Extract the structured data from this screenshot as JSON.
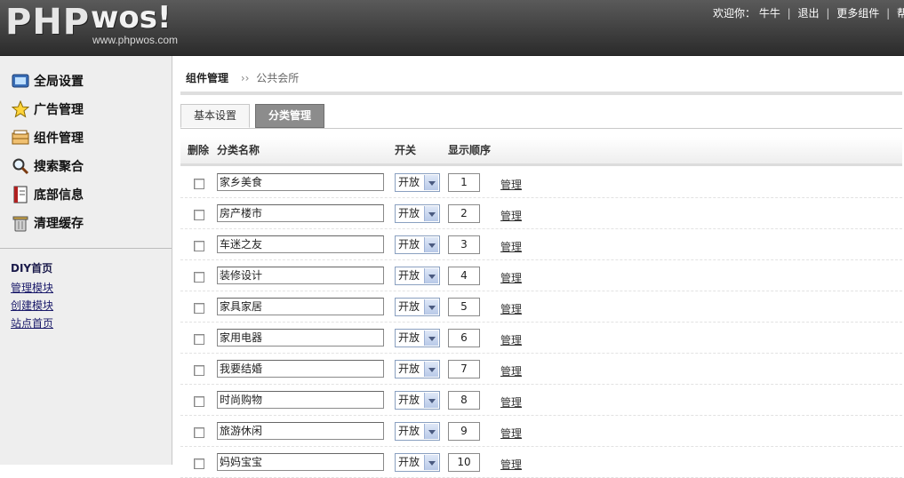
{
  "header": {
    "logo_main": "PHP",
    "logo_sub": "wos!",
    "logo_url": "www.phpwos.com",
    "welcome": "欢迎你：",
    "username": "牛牛",
    "logout": "退出",
    "more_components": "更多组件",
    "help": "帮"
  },
  "sidebar": {
    "menu": [
      {
        "label": "全局设置",
        "icon": "monitor-icon"
      },
      {
        "label": "广告管理",
        "icon": "star-icon"
      },
      {
        "label": "组件管理",
        "icon": "drawer-icon"
      },
      {
        "label": "搜索聚合",
        "icon": "search-icon"
      },
      {
        "label": "底部信息",
        "icon": "document-icon"
      },
      {
        "label": "清理缓存",
        "icon": "trash-icon"
      }
    ],
    "diy_title": "DIY首页",
    "diy_links": [
      "管理模块",
      "创建模块",
      "站点首页"
    ]
  },
  "breadcrumb": {
    "section": "组件管理",
    "arrow": "››",
    "current": "公共会所"
  },
  "tabs": [
    {
      "label": "基本设置",
      "active": false
    },
    {
      "label": "分类管理",
      "active": true
    }
  ],
  "table": {
    "headers": {
      "delete": "删除",
      "name": "分类名称",
      "switch": "开关",
      "order": "显示顺序"
    },
    "rows": [
      {
        "name": "家乡美食",
        "switch": "开放",
        "order": "1",
        "action": "管理"
      },
      {
        "name": "房产楼市",
        "switch": "开放",
        "order": "2",
        "action": "管理"
      },
      {
        "name": "车迷之友",
        "switch": "开放",
        "order": "3",
        "action": "管理"
      },
      {
        "name": "装修设计",
        "switch": "开放",
        "order": "4",
        "action": "管理"
      },
      {
        "name": "家具家居",
        "switch": "开放",
        "order": "5",
        "action": "管理"
      },
      {
        "name": "家用电器",
        "switch": "开放",
        "order": "6",
        "action": "管理"
      },
      {
        "name": "我要结婚",
        "switch": "开放",
        "order": "7",
        "action": "管理"
      },
      {
        "name": "时尚购物",
        "switch": "开放",
        "order": "8",
        "action": "管理"
      },
      {
        "name": "旅游休闲",
        "switch": "开放",
        "order": "9",
        "action": "管理"
      },
      {
        "name": "妈妈宝宝",
        "switch": "开放",
        "order": "10",
        "action": "管理"
      }
    ]
  }
}
